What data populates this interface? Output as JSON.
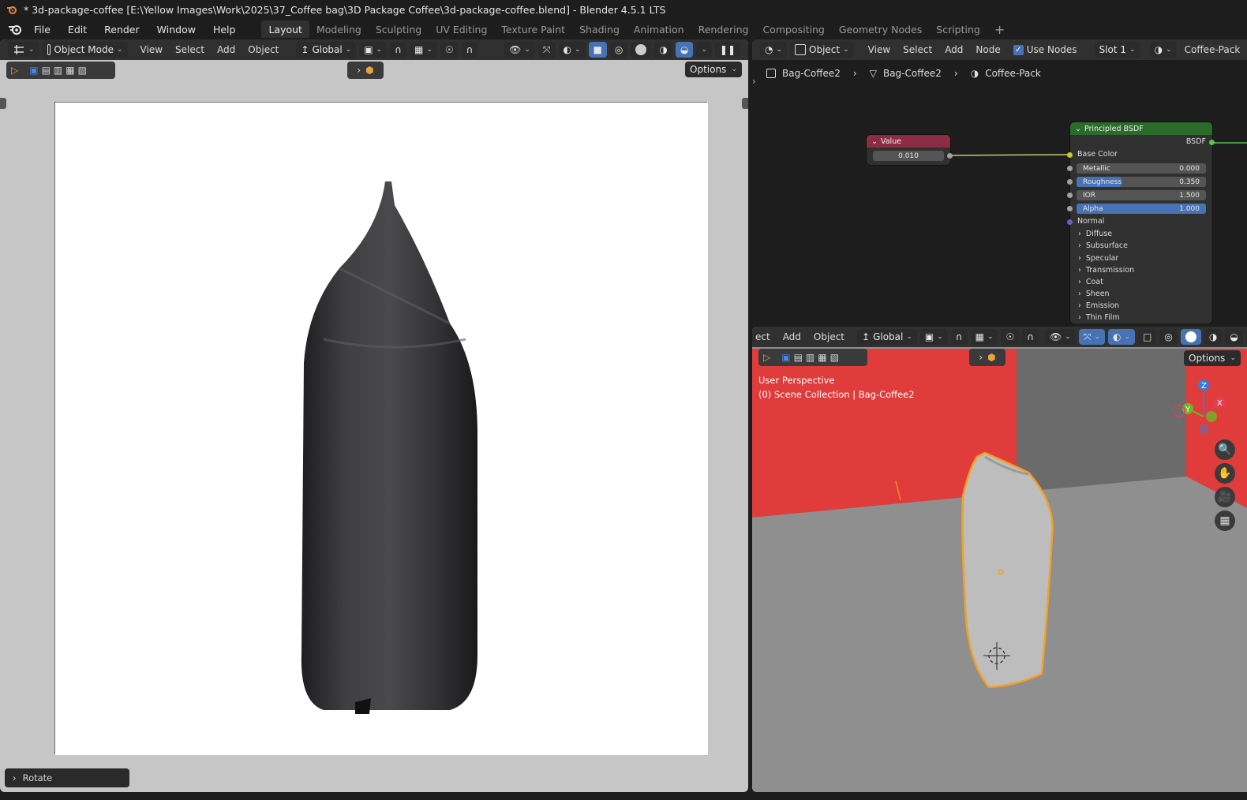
{
  "window": {
    "title": "* 3d-package-coffee [E:\\Yellow Images\\Work\\2025\\37_Coffee bag\\3D Package Coffee\\3d-package-coffee.blend] - Blender 4.5.1 LTS"
  },
  "menu": [
    "File",
    "Edit",
    "Render",
    "Window",
    "Help"
  ],
  "workspaces": [
    "Layout",
    "Modeling",
    "Sculpting",
    "UV Editing",
    "Texture Paint",
    "Shading",
    "Animation",
    "Rendering",
    "Compositing",
    "Geometry Nodes",
    "Scripting"
  ],
  "active_workspace": "Layout",
  "add_workspace_label": "+",
  "left_viewport": {
    "mode": "Object Mode",
    "menus": [
      "View",
      "Select",
      "Add",
      "Object"
    ],
    "transform_orientation": "Global",
    "options_label": "Options",
    "operator_panel": "Rotate",
    "background_color": "#ffffff",
    "bag_color": "#3a3a3c"
  },
  "node_editor": {
    "editor_type": "Object",
    "menus": [
      "View",
      "Select",
      "Add",
      "Node"
    ],
    "use_nodes_label": "Use Nodes",
    "use_nodes": true,
    "slot": "Slot 1",
    "material": "Coffee-Pack",
    "breadcrumb": [
      "Bag-Coffee2",
      "Bag-Coffee2",
      "Coffee-Pack"
    ],
    "value_node": {
      "title": "Value",
      "value": "0.010",
      "header_color": "#8b2c44"
    },
    "bsdf_node": {
      "title": "Principled BSDF",
      "output": "BSDF",
      "header_color": "#2a6a2a",
      "base_color_label": "Base Color",
      "inputs": [
        {
          "label": "Metallic",
          "value": "0.000",
          "fill": 0.0
        },
        {
          "label": "Roughness",
          "value": "0.350",
          "fill": 0.35
        },
        {
          "label": "IOR",
          "value": "1.500",
          "fill": 0.0
        },
        {
          "label": "Alpha",
          "value": "1.000",
          "fill": 1.0
        }
      ],
      "normal_label": "Normal",
      "panels": [
        "Diffuse",
        "Subsurface",
        "Specular",
        "Transmission",
        "Coat",
        "Sheen",
        "Emission",
        "Thin Film"
      ]
    }
  },
  "right_viewport": {
    "menus": [
      "ect",
      "Add",
      "Object"
    ],
    "transform_orientation": "Global",
    "options_label": "Options",
    "perspective": "User Perspective",
    "collection": "(0) Scene Collection | Bag-Coffee2",
    "gizmo_axes": [
      "Z",
      "Y",
      "X"
    ],
    "wall_color": "#e03c3c",
    "floor_color": "#8f8f8f",
    "selection_color": "#f5a020"
  }
}
